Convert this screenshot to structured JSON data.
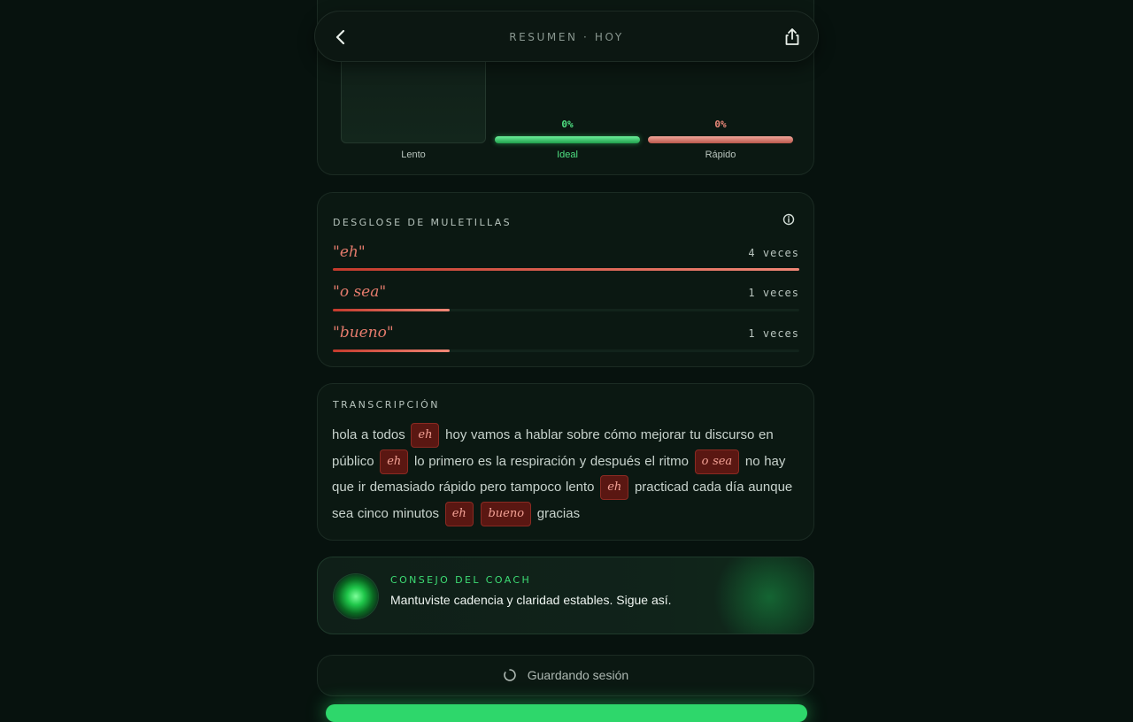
{
  "header": {
    "title": "RESUMEN · HOY"
  },
  "speed": {
    "bars": [
      {
        "label": "Lento",
        "percent": "",
        "color": "#3a4a40"
      },
      {
        "label": "Ideal",
        "percent": "0%",
        "color": "#3ddc74"
      },
      {
        "label": "Rápido",
        "percent": "0%",
        "color": "#e0786a"
      }
    ]
  },
  "fillers": {
    "title": "DESGLOSE DE MULETILLAS",
    "items": [
      {
        "word": "\"eh\"",
        "count": "4 veces",
        "fraction": 1.0
      },
      {
        "word": "\"o sea\"",
        "count": "1 veces",
        "fraction": 0.25
      },
      {
        "word": "\"bueno\"",
        "count": "1 veces",
        "fraction": 0.25
      }
    ]
  },
  "transcript": {
    "title": "TRANSCRIPCIÓN",
    "segments": [
      "hola a todos",
      "eh",
      "hoy vamos a hablar sobre cómo mejorar tu discurso en público",
      "eh",
      "lo primero es la respiración y después el ritmo",
      "o sea",
      "no hay que ir demasiado rápido pero tampoco lento",
      "eh",
      "practicad cada día aunque sea cinco minutos",
      "eh",
      "bueno",
      "gracias"
    ]
  },
  "coach": {
    "title": "CONSEJO DEL COACH",
    "message": "Mantuviste cadencia y claridad estables. Sigue así."
  },
  "saving": {
    "text": "Guardando sesión"
  },
  "colors": {
    "accent": "#3ddc74",
    "filler": "#e47b6c",
    "background": "#07120e"
  }
}
